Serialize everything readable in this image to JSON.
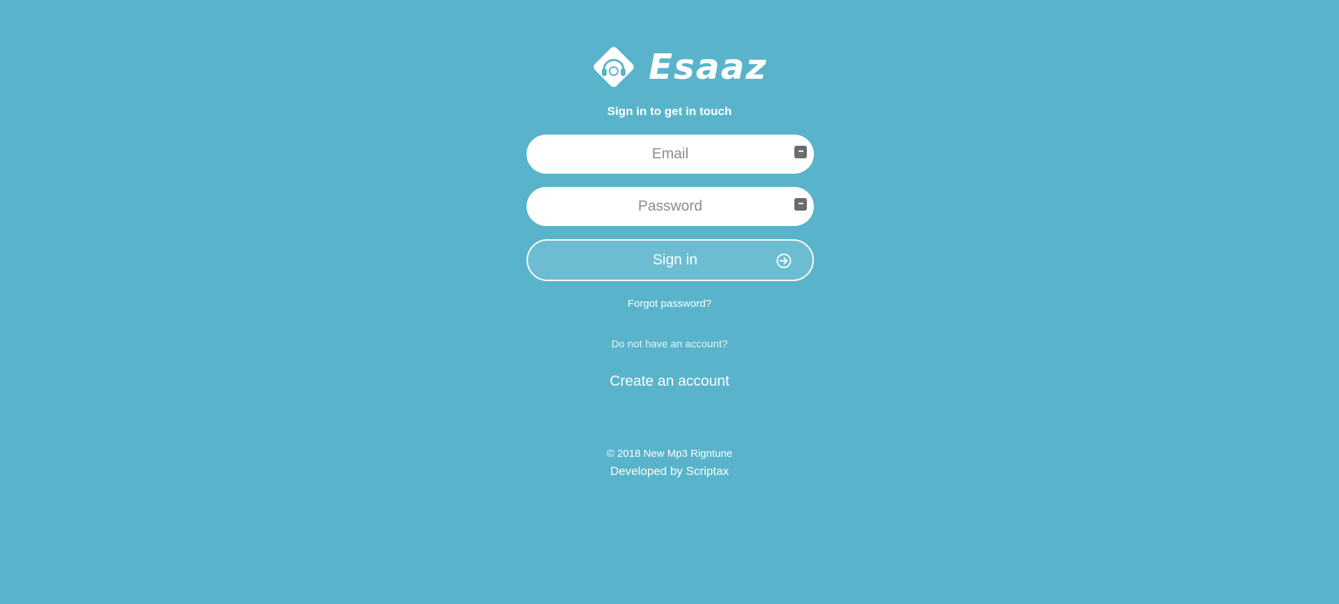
{
  "brand": {
    "name": "Esaaz",
    "logo_icon": "headphones-diamond-icon"
  },
  "subtitle": "Sign in to get in touch",
  "form": {
    "email_placeholder": "Email",
    "email_icon": "ellipsis-key-icon",
    "password_placeholder": "Password",
    "password_icon": "ellipsis-key-icon",
    "signin_label": "Sign in",
    "signin_icon": "arrow-right-circle-icon"
  },
  "links": {
    "forgot_password": "Forgot password?",
    "no_account": "Do not have an account?",
    "create_account": "Create an account"
  },
  "footer": {
    "copyright": "© 2018 New Mp3 Rigntune",
    "developed_by": "Developed by Scriptax"
  },
  "colors": {
    "background": "#59b4cb",
    "button_fill": "#6cbdd1",
    "text": "#ffffff"
  }
}
